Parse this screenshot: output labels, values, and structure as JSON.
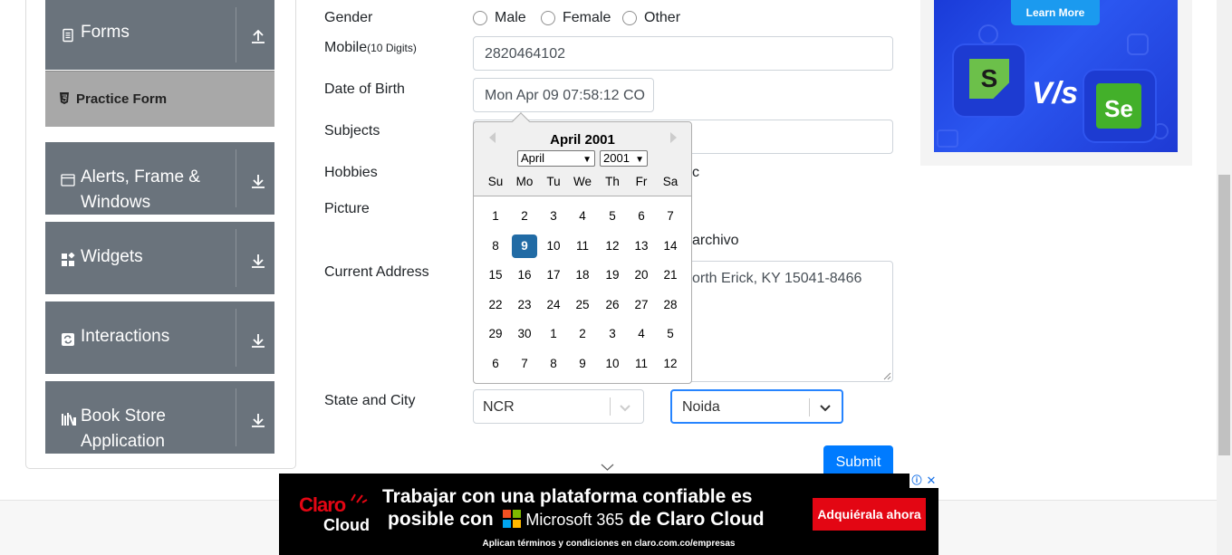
{
  "sidebar": {
    "groups": [
      {
        "title": "Forms",
        "icon": "document-icon"
      },
      {
        "title_line1": "Alerts, Frame &",
        "title_line2": "Windows",
        "icon": "window-icon"
      },
      {
        "title": "Widgets",
        "icon": "widgets-icon"
      },
      {
        "title": "Interactions",
        "icon": "interactions-icon"
      },
      {
        "title_line1": "Book Store",
        "title_line2": "Application",
        "icon": "books-icon"
      }
    ],
    "active_item": "Practice Form"
  },
  "form": {
    "gender_label": "Gender",
    "gender_options": [
      "Male",
      "Female",
      "Other"
    ],
    "mobile_label": "Mobile",
    "mobile_hint": "(10 Digits)",
    "mobile_value": "2820464102",
    "dob_label": "Date of Birth",
    "dob_value": "Mon Apr 09 07:58:12 CO",
    "subjects_label": "Subjects",
    "hobbies_label": "Hobbies",
    "hobbies_partial": "c",
    "picture_label": "Picture",
    "picture_partial": "archivo",
    "address_label": "Current Address",
    "address_value": "orth Erick, KY 15041-8466",
    "state_city_label": "State and City",
    "state_value": "NCR",
    "city_value": "Noida",
    "submit_label": "Submit"
  },
  "calendar": {
    "title": "April 2001",
    "month_select": "April",
    "year_select": "2001",
    "weekdays": [
      "Su",
      "Mo",
      "Tu",
      "We",
      "Th",
      "Fr",
      "Sa"
    ],
    "weeks": [
      [
        "1",
        "2",
        "3",
        "4",
        "5",
        "6",
        "7"
      ],
      [
        "8",
        "9",
        "10",
        "11",
        "12",
        "13",
        "14"
      ],
      [
        "15",
        "16",
        "17",
        "18",
        "19",
        "20",
        "21"
      ],
      [
        "22",
        "23",
        "24",
        "25",
        "26",
        "27",
        "28"
      ],
      [
        "29",
        "30",
        "1",
        "2",
        "3",
        "4",
        "5"
      ],
      [
        "6",
        "7",
        "8",
        "9",
        "10",
        "11",
        "12"
      ]
    ],
    "selected_day": "9"
  },
  "right_ad": {
    "button": "Learn More",
    "vs_text": "V/s",
    "logo_left": "S",
    "logo_right": "Se"
  },
  "bottom_ad": {
    "brand_line1": "Claro",
    "brand_line2": "Cloud",
    "headline_line1": "Trabajar con una plataforma confiable es",
    "headline_line2a": "posible con",
    "headline_ms": "Microsoft 365",
    "headline_line2b": "de Claro Cloud",
    "cta": "Adquiérala ahora",
    "footnote": "Aplican términos y condiciones en claro.com.co/empresas"
  },
  "colors": {
    "sidebar_bg": "#6a737c",
    "active_bg": "#a8a8a8",
    "primary": "#007bff",
    "selected_day": "#216ba5",
    "claro_red": "#e30613"
  }
}
